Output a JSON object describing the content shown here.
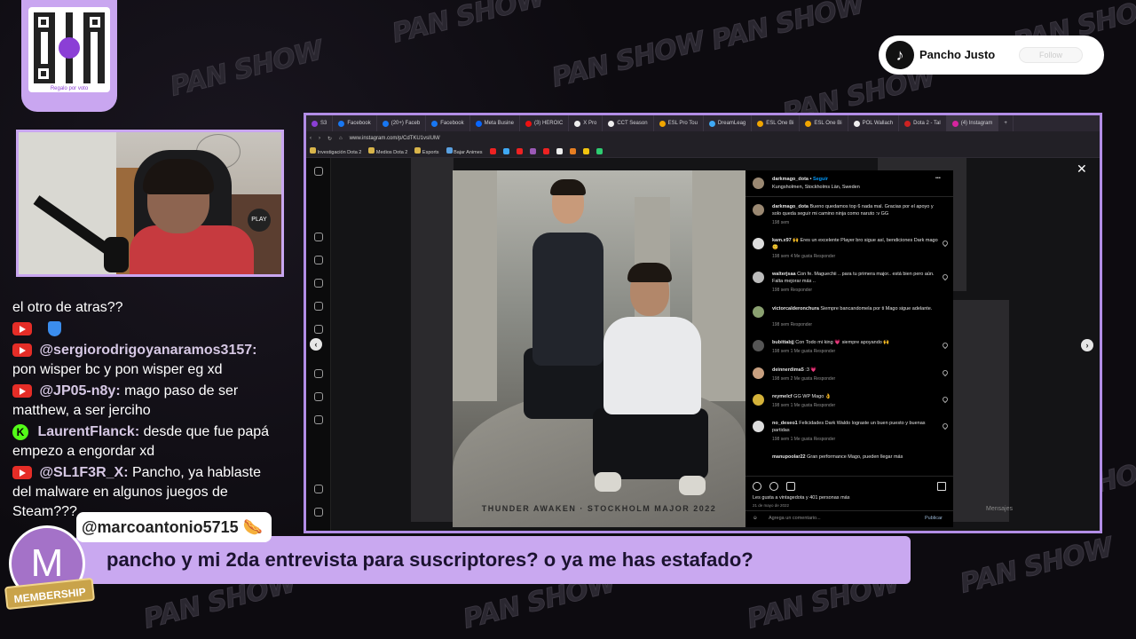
{
  "overlay": {
    "qr_caption": "Regalo por voto",
    "webcam_badge": "PLAY",
    "background_tile": "PAN SHOW"
  },
  "chat": {
    "messages": [
      {
        "user": "",
        "text": "el otro de atras??"
      },
      {
        "user": "@sergiorodrigoyanaramos3157:",
        "text": "pon wisper bc y pon wisper eg xd"
      },
      {
        "user": "@JP05-n8y:",
        "text": "mago paso de ser matthew, a ser jerciho"
      },
      {
        "user": "LaurentFlanck:",
        "text": "desde que fue papá empezo a engordar xd"
      },
      {
        "user": "@SL1F3R_X:",
        "text": "Pancho, ya hablaste del malware en algunos juegos de Steam???"
      }
    ]
  },
  "tiktok": {
    "name": "Pancho Justo",
    "follow_label": "Follow"
  },
  "browser": {
    "tabs": [
      "Facebook",
      "(20+) Faceb",
      "Facebook",
      "Meta Busine",
      "(3) HEROIC",
      "X Pro",
      "CCT Season",
      "ESL Pro Tou",
      "DreamLeag",
      "ESL One Bi",
      "ESL One Bi",
      "POL Wallach",
      "Dota 2 - Tal",
      "(4) Instagram"
    ],
    "url": "www.instagram.com/p/CdTKU1vsIUM/",
    "bookmarks": [
      "Investigación Dota 2",
      "Medios Dota 2",
      "Esports",
      "Bajar Animes"
    ]
  },
  "post": {
    "image_caption": "THUNDER AWAKEN · STOCKHOLM MAJOR 2022",
    "author": "darkmago_dota",
    "follow": "Seguir",
    "location": "Kungsholmen, Stockholms Län, Sweden",
    "comments": [
      {
        "user": "darkmago_dota",
        "text": "Bueno quedamos top 6 nada mal. Gracias por el apoyo y solo queda seguir mi camino ninja como naruto :v GG",
        "meta": "198 sem"
      },
      {
        "user": "kam.x97",
        "text": "🙌 Eres un excelente Player bro sigue así, bendiciones Dark mago😊",
        "meta": "198 sem   4 Me gusta   Responder"
      },
      {
        "user": "walterjsaa",
        "text": "Con fe. Maguechii .. para tu primera major.. está bien pero aún. Falta mejorar más ..",
        "meta": "198 sem   Responder"
      },
      {
        "user": "victorcalderonchura",
        "text": "Siempre bancandomela por ti Mago sigue adelante.",
        "meta": "198 sem   Responder"
      },
      {
        "user": "bubittabjj",
        "text": "Con Todo mi king 💗 siempre apoyando 🙌",
        "meta": "198 sem   1 Me gusta   Responder"
      },
      {
        "user": "deinnerdima5",
        "text": ":3 💗",
        "meta": "198 sem   2 Me gusta   Responder"
      },
      {
        "user": "reymelcf",
        "text": "GG WP Mago 👌",
        "meta": "198 sem   1 Me gusta   Responder"
      },
      {
        "user": "no_deseo1",
        "text": "Felicidades Dark Waldo lograste un buen puesto y buenas partidas",
        "meta": "198 sem   1 Me gusta   Responder"
      },
      {
        "user": "manupoolar22",
        "text": "Gran performance Mago, pueden llegar más",
        "meta": ""
      }
    ],
    "likes": "Les gusta a vintagedota y 401 personas más",
    "date": "21 de mayo de 2022",
    "comment_placeholder": "Agrega un comentario...",
    "publish": "Publicar",
    "messages_label": "Mensajes"
  },
  "membership": {
    "username": "@marcoantonio5715 🌭",
    "message": "pancho y mi 2da entrevista para suscriptores? o ya me has estafado?",
    "avatar_letter": "M",
    "badge": "MEMBERSHIP"
  },
  "colors": {
    "accent": "#c9a8f0",
    "youtube": "#e52d27",
    "kick": "#53fc18"
  }
}
